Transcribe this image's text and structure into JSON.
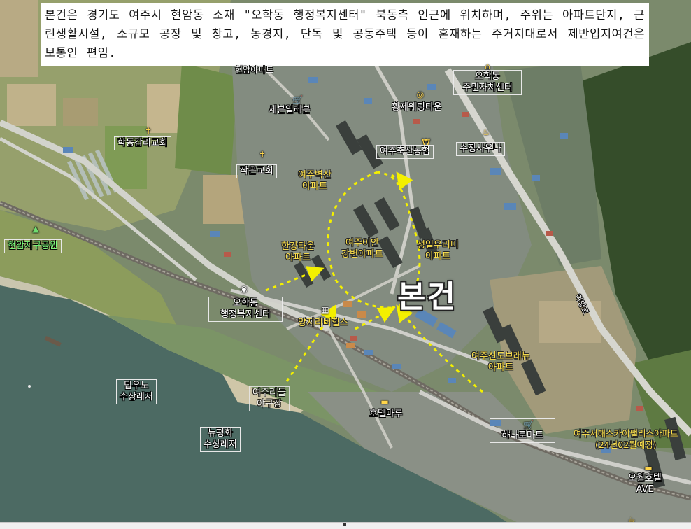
{
  "description": "본건은 경기도 여주시 현암동 소재 \"오학동 행정복지센터\" 북동측 인근에 위치하며, 주위는 아파트단지, 근린생활시설, 소규모 공장 및 창고, 농경지, 단독 및 공동주택 등이 혼재하는 주거지대로서 제반입지여건은 보통인 편임.",
  "subject_label": "본건",
  "road_label": "여양로",
  "labels": {
    "hakdong_church": "학동감리교회",
    "small_church": "작은교회",
    "seven_eleven": "세븐일레븐",
    "hwangje_wedding": "황제웨딩타운",
    "ohak_center_top_1": "오학동",
    "ohak_center_top_2": "주민자치센터",
    "livestock_coop": "여주축산농협",
    "sujeong_sauna": "수정사우나",
    "byeoksan_1": "여주벽산",
    "byeoksan_2": "아파트",
    "hyeonam_park": "현암지구공원",
    "hangang_town_1": "한강타운",
    "hangang_town_2": "아파트",
    "ian_1": "여주이안",
    "ian_2": "강변아파트",
    "seongil_1": "성일우리미",
    "seongil_2": "아파트",
    "ohak_office_1": "오학동",
    "ohak_office_2": "행정복지센터",
    "yangji_hills": "양지리버힐스",
    "shindo_1": "여주신도브래뉴",
    "shindo_2": "아파트",
    "tipuno_1": "팁우노",
    "tipuno_2": "수상레저",
    "rideul_1": "여주리들",
    "rideul_2": "야구장",
    "hotel_maru": "호텔마루",
    "hana_mart": "하나로마트",
    "newpeace_1": "뉴평화",
    "newpeace_2": "수상레저",
    "skypalace_1": "여주서해스카이팰리스아파트",
    "skypalace_2": "(24년02월예정)",
    "owol_hotel_1": "오월호텔",
    "owol_hotel_2": "AVE",
    "top_partial": "현암아파트"
  },
  "icons": {
    "church": "church-icon",
    "store": "cart-icon",
    "wedding": "ring-icon",
    "office": "building-icon",
    "finance": "coin-icon",
    "sauna": "hot-spring-icon",
    "park": "tree-icon",
    "landmark": "target-icon",
    "hotel": "bed-icon"
  },
  "colors": {
    "arrow": "#f4f000",
    "river": "#4a6a62",
    "road": "#cfd0c8",
    "field": "#8fa064",
    "urban": "#7d8a7a",
    "forest": "#2f4a26"
  }
}
